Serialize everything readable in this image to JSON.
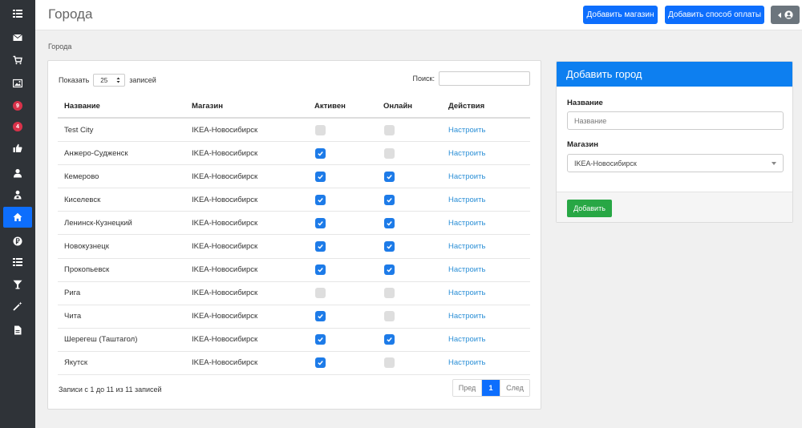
{
  "sidebar": {
    "items": [
      {
        "icon": "list-icon"
      },
      {
        "icon": "envelope-icon"
      },
      {
        "icon": "cart-icon"
      },
      {
        "icon": "image-icon"
      },
      {
        "icon": "badge",
        "badge": "9"
      },
      {
        "icon": "badge",
        "badge": "4"
      },
      {
        "icon": "thumbs-up-icon"
      },
      {
        "icon": "user-icon"
      },
      {
        "icon": "user-lock-icon"
      },
      {
        "icon": "home-icon",
        "active": true
      },
      {
        "icon": "ruble-icon"
      },
      {
        "icon": "list-icon"
      },
      {
        "icon": "filter-icon"
      },
      {
        "icon": "magic-wand-icon"
      },
      {
        "icon": "document-icon"
      }
    ]
  },
  "header": {
    "title": "Города",
    "add_store": "Добавить магазин",
    "add_payment": "Добавить способ оплаты"
  },
  "breadcrumb": "Города",
  "table_controls": {
    "show_label": "Показать",
    "page_length": "25",
    "records_label": "записей",
    "search_label": "Поиск:",
    "search_value": ""
  },
  "table": {
    "columns": [
      "Название",
      "Магазин",
      "Активен",
      "Онлайн",
      "Действия"
    ],
    "rows": [
      {
        "name": "Test City",
        "store": "IKEA-Новосибирск",
        "active": false,
        "online": false,
        "action": "Настроить"
      },
      {
        "name": "Анжеро-Судженск",
        "store": "IKEA-Новосибирск",
        "active": true,
        "online": false,
        "action": "Настроить"
      },
      {
        "name": "Кемерово",
        "store": "IKEA-Новосибирск",
        "active": true,
        "online": true,
        "action": "Настроить"
      },
      {
        "name": "Киселевск",
        "store": "IKEA-Новосибирск",
        "active": true,
        "online": true,
        "action": "Настроить"
      },
      {
        "name": "Ленинск-Кузнецкий",
        "store": "IKEA-Новосибирск",
        "active": true,
        "online": true,
        "action": "Настроить"
      },
      {
        "name": "Новокузнецк",
        "store": "IKEA-Новосибирск",
        "active": true,
        "online": true,
        "action": "Настроить"
      },
      {
        "name": "Прокопьевск",
        "store": "IKEA-Новосибирск",
        "active": true,
        "online": true,
        "action": "Настроить"
      },
      {
        "name": "Рига",
        "store": "IKEA-Новосибирск",
        "active": false,
        "online": false,
        "action": "Настроить"
      },
      {
        "name": "Чита",
        "store": "IKEA-Новосибирск",
        "active": true,
        "online": false,
        "action": "Настроить"
      },
      {
        "name": "Шерегеш (Таштагол)",
        "store": "IKEA-Новосибирск",
        "active": true,
        "online": true,
        "action": "Настроить"
      },
      {
        "name": "Якутск",
        "store": "IKEA-Новосибирск",
        "active": true,
        "online": false,
        "action": "Настроить"
      }
    ]
  },
  "pagination": {
    "info": "Записи с 1 до 11 из 11 записей",
    "prev": "Пред",
    "current": "1",
    "next": "След"
  },
  "add_city_form": {
    "title": "Добавить город",
    "name_label": "Название",
    "name_placeholder": "Название",
    "store_label": "Магазин",
    "store_value": "IKEA-Новосибирск",
    "submit": "Добавить"
  },
  "colors": {
    "primary": "#0d6efd",
    "success": "#28a745",
    "sidebar": "#2f3338",
    "badge": "#d9324a",
    "link": "#2b8fd6"
  }
}
